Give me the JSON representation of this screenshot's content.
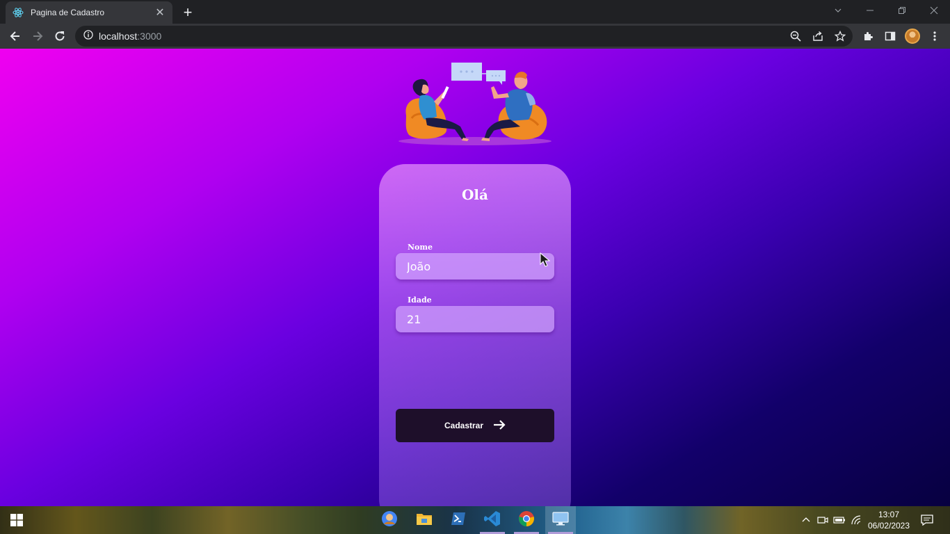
{
  "browser": {
    "tab_title": "Pagina de Cadastro",
    "tab_close_glyph": "✕",
    "new_tab_glyph": "+",
    "url_host": "localhost",
    "url_port": ":3000",
    "window_controls": [
      "chevron-down-icon",
      "minimize-icon",
      "restore-icon",
      "close-icon"
    ]
  },
  "form": {
    "title": "Olá",
    "name_label": "Nome",
    "name_value": "João",
    "age_label": "Idade",
    "age_value": "21",
    "submit_label": "Cadastrar"
  },
  "taskbar": {
    "time": "13:07",
    "date": "06/02/2023",
    "apps": [
      "chrome-profile-icon",
      "file-explorer-icon",
      "powershell-icon",
      "vscode-icon",
      "chrome-icon",
      "remote-desktop-icon"
    ]
  },
  "colors": {
    "accent": "#b19cd9",
    "button_bg": "#1e0f2a",
    "page_gradient_start": "#f000f0",
    "page_gradient_end": "#070040"
  }
}
